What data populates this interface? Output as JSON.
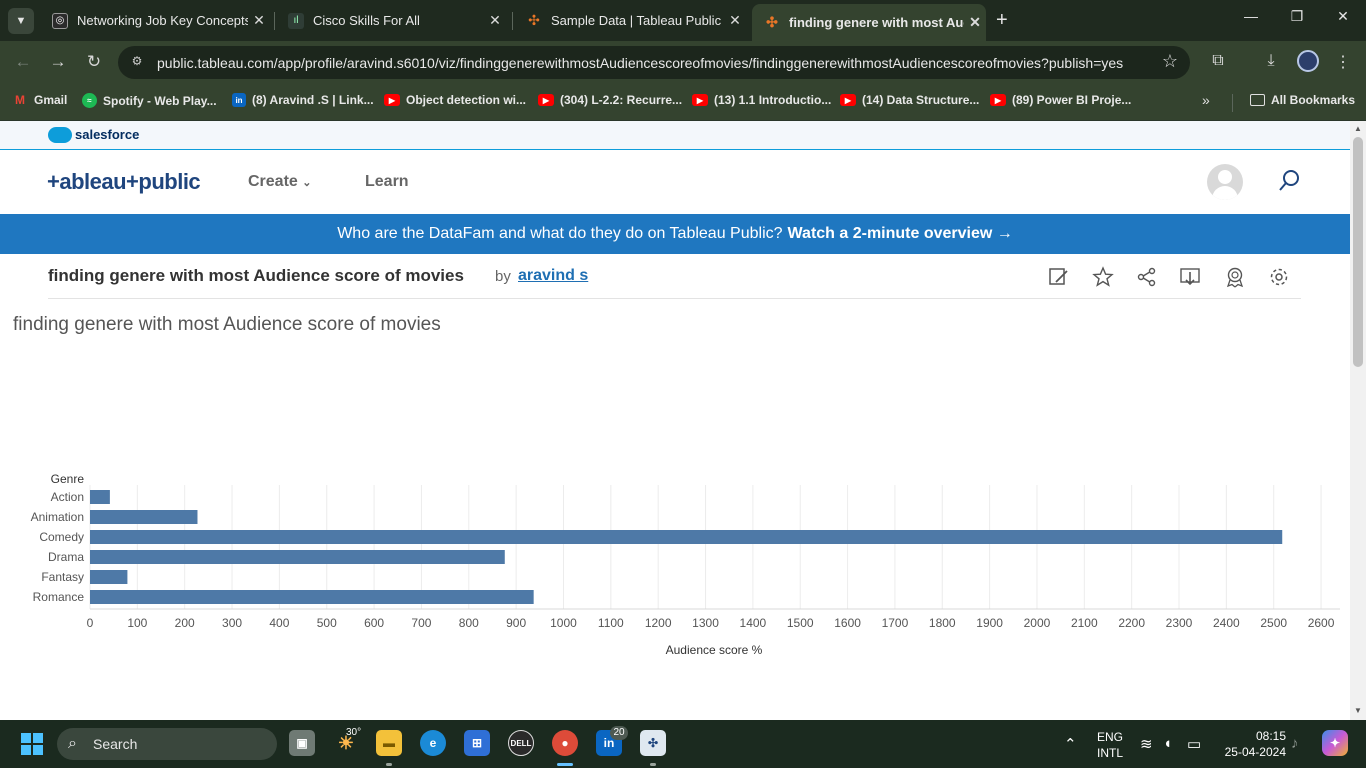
{
  "browser": {
    "tab_menu_icon": "chevron-down",
    "tabs": [
      {
        "title": "Networking Job Key Concepts",
        "favicon": "openai-icon",
        "close": "✕",
        "active": false
      },
      {
        "title": "Cisco Skills For All",
        "favicon": "cisco-icon",
        "close": "✕",
        "active": false
      },
      {
        "title": "Sample Data | Tableau Public",
        "favicon": "tableau-icon",
        "close": "✕",
        "active": false
      },
      {
        "title": "finding genere with most Audience score of movies",
        "favicon": "tableau-icon",
        "close": "✕",
        "active": true
      }
    ],
    "new_tab": "+",
    "window_controls": {
      "minimize": "—",
      "restore": "❐",
      "close": "✕"
    },
    "url": "public.tableau.com/app/profile/aravind.s6010/viz/findinggenerewithmostAudiencescoreofmovies/findinggenerewithmostAudiencescoreofmovies?publish=yes",
    "bookmarks": [
      {
        "label": "Gmail",
        "icon": "gmail-icon",
        "color": "#ea4335"
      },
      {
        "label": "Spotify - Web Play...",
        "icon": "spotify-icon",
        "color": "#1db954"
      },
      {
        "label": "(8) Aravind .S | Link...",
        "icon": "linkedin-icon",
        "color": "#0a66c2"
      },
      {
        "label": "Object detection wi...",
        "icon": "youtube-icon",
        "color": "#ff0000"
      },
      {
        "label": "(304) L-2.2: Recurre...",
        "icon": "youtube-icon",
        "color": "#ff0000"
      },
      {
        "label": "(13) 1.1 Introductio...",
        "icon": "youtube-icon",
        "color": "#ff0000"
      },
      {
        "label": "(14) Data Structure...",
        "icon": "youtube-icon",
        "color": "#ff0000"
      },
      {
        "label": "(89) Power BI Proje...",
        "icon": "youtube-icon",
        "color": "#ff0000"
      }
    ],
    "bookmarks_more": "»",
    "all_bookmarks": "All Bookmarks"
  },
  "page": {
    "salesforce_label": "salesforce",
    "logo_text": "+ableau+public",
    "nav": {
      "create": "Create",
      "learn": "Learn"
    },
    "banner_text": "Who are the DataFam and what do they do on Tableau Public?",
    "banner_link": "Watch a 2-minute overview →",
    "viz_title": "finding genere with most Audience score of movies",
    "by_label": "by",
    "author": "aravind s",
    "brand_color": "#1f77c0"
  },
  "chart_data": {
    "type": "bar",
    "orientation": "horizontal",
    "title": "finding genere with most Audience score of movies",
    "category_header": "Genre",
    "categories": [
      "Action",
      "Animation",
      "Comedy",
      "Drama",
      "Fantasy",
      "Romance"
    ],
    "values": [
      42,
      227,
      2518,
      876,
      79,
      937
    ],
    "xlabel": "Audience score %",
    "xticks": [
      0,
      100,
      200,
      300,
      400,
      500,
      600,
      700,
      800,
      900,
      1000,
      1100,
      1200,
      1300,
      1400,
      1500,
      1600,
      1700,
      1800,
      1900,
      2000,
      2100,
      2200,
      2300,
      2400,
      2500,
      2600
    ],
    "xlim": [
      0,
      2640
    ],
    "grid": true,
    "bar_color": "#4e79a7"
  },
  "taskbar": {
    "search_label": "Search",
    "weather_temp": "30°",
    "linkedin_badge": "20",
    "lang_line1": "ENG",
    "lang_line2": "INTL",
    "time": "08:15",
    "date": "25-04-2024"
  }
}
